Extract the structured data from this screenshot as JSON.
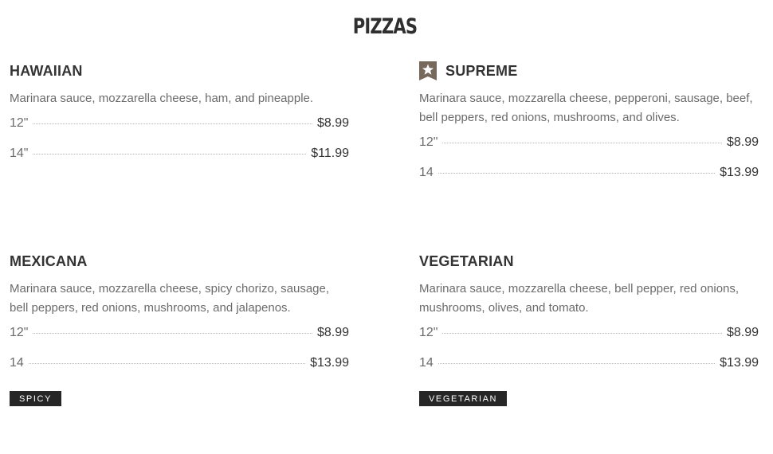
{
  "page": {
    "title": "PIZZAS"
  },
  "items": [
    {
      "name": "HAWAIIAN",
      "description": "Marinara sauce, mozzarella cheese, ham, and pineapple.",
      "prices": [
        {
          "size": "12\"",
          "price": "$8.99"
        },
        {
          "size": "14\"",
          "price": "$11.99"
        }
      ]
    },
    {
      "name": "SUPREME",
      "featured_icon": "star-ribbon-icon",
      "description": "Marinara sauce, mozzarella cheese, pepperoni, sausage, beef, bell peppers, red onions, mushrooms, and olives.",
      "prices": [
        {
          "size": "12\"",
          "price": "$8.99"
        },
        {
          "size": "14",
          "price": "$13.99"
        }
      ]
    },
    {
      "name": "MEXICANA",
      "description": "Marinara sauce, mozzarella cheese, spicy chorizo, sausage, bell peppers, red onions, mushrooms, and jalapenos.",
      "prices": [
        {
          "size": "12\"",
          "price": "$8.99"
        },
        {
          "size": "14",
          "price": "$13.99"
        }
      ],
      "tag": "SPICY"
    },
    {
      "name": "VEGETARIAN",
      "description": "Marinara sauce, mozzarella cheese, bell pepper, red onions, mushrooms, olives, and tomato.",
      "prices": [
        {
          "size": "12\"",
          "price": "$8.99"
        },
        {
          "size": "14",
          "price": "$13.99"
        }
      ],
      "tag": "VEGETARIAN"
    }
  ],
  "colors": {
    "badge": "#77685c",
    "tag_background": "#262626",
    "text": "#333333",
    "muted_text": "#6b6b6b"
  }
}
